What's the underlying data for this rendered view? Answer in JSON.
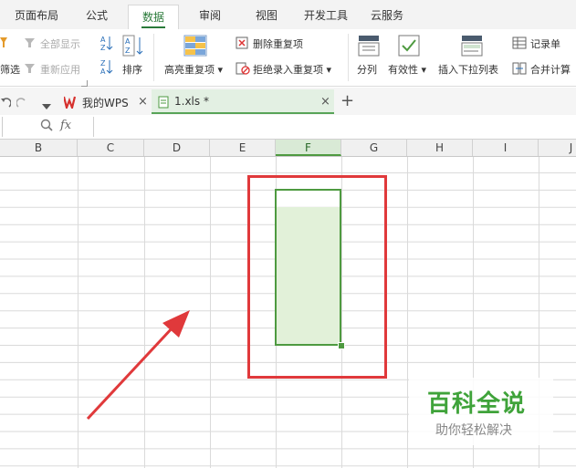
{
  "menu": {
    "tabs": [
      "页面布局",
      "公式",
      "数据",
      "审阅",
      "视图",
      "开发工具",
      "云服务"
    ]
  },
  "ribbon": {
    "show_all": "全部显示",
    "filter": "筛选",
    "reapply": "重新应用",
    "sort": "排序",
    "highlight_dup": "高亮重复项",
    "delete_dup": "删除重复项",
    "reject_dup": "拒绝录入重复项",
    "split": "分列",
    "validity": "有效性",
    "insert_dropdown": "插入下拉列表",
    "record_form": "记录单",
    "consolidate": "合并计算"
  },
  "doc_tabs": {
    "wps_label": "我的WPS",
    "file_label": "1.xls *",
    "add": "+"
  },
  "formula_bar": {
    "fx": "fx"
  },
  "sheet": {
    "columns": [
      "B",
      "C",
      "D",
      "E",
      "F",
      "G",
      "H",
      "I",
      "J"
    ],
    "selected_column": "F"
  },
  "watermark": {
    "title": "百科全说",
    "subtitle": "助你轻松解决"
  },
  "colors": {
    "accent": "#4e9a40",
    "annotation": "#e0393b",
    "selection_fill": "#e2f1d9"
  }
}
